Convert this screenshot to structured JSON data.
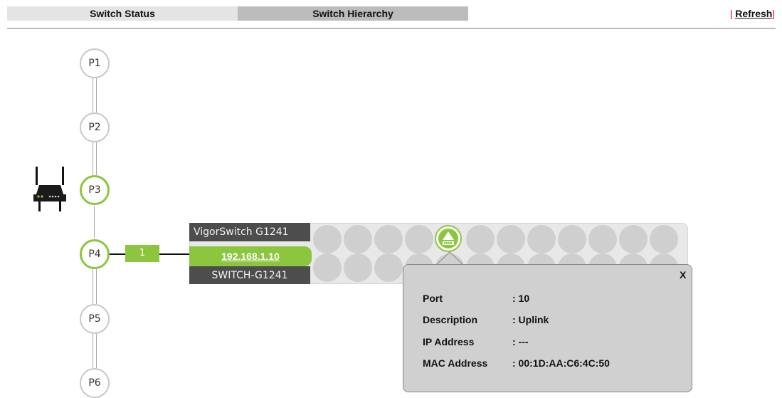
{
  "tabs": {
    "switch_status": "Switch Status",
    "switch_hierarchy": "Switch Hierarchy"
  },
  "refresh": {
    "sep": "|",
    "label": "Refresh"
  },
  "tree": {
    "ports": [
      "P1",
      "P2",
      "P3",
      "P4",
      "P5",
      "P6"
    ],
    "link_port_label": "1"
  },
  "switch": {
    "model": "VigorSwitch G1241",
    "ip": "192.168.1.10",
    "hostname": "SWITCH-G1241"
  },
  "popup": {
    "close_label": "X",
    "rows": [
      {
        "label": "Port",
        "value": ": 10"
      },
      {
        "label": "Description",
        "value": ": Uplink"
      },
      {
        "label": "IP Address",
        "value": ": ---"
      },
      {
        "label": "MAC Address",
        "value": ": 00:1D:AA:C6:4C:50"
      }
    ]
  },
  "colors": {
    "accent_green": "#8cc63f",
    "dark_gray": "#4d4d4d",
    "refresh_separator": "#d00000"
  },
  "icons": [
    "router-icon",
    "uplink-port-icon",
    "close-icon"
  ]
}
